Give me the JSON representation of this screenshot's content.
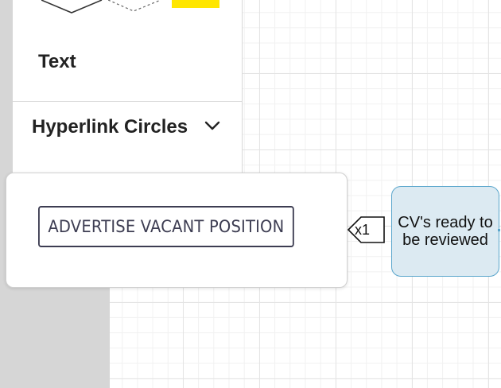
{
  "sidebar": {
    "text_item_label": "Text",
    "section_title": "Hyperlink Circles",
    "shapes": [
      "diamond",
      "dashed-diamond",
      "yellow-rectangle"
    ],
    "accent_yellow": "#ffe600"
  },
  "popup": {
    "button_label": "ADVERTISE VACANT POSITION"
  },
  "canvas": {
    "connector_label": "x1",
    "node_label": "CV's ready to be reviewed",
    "node_fill": "#dceaf2",
    "node_border": "#5aa6cc"
  }
}
